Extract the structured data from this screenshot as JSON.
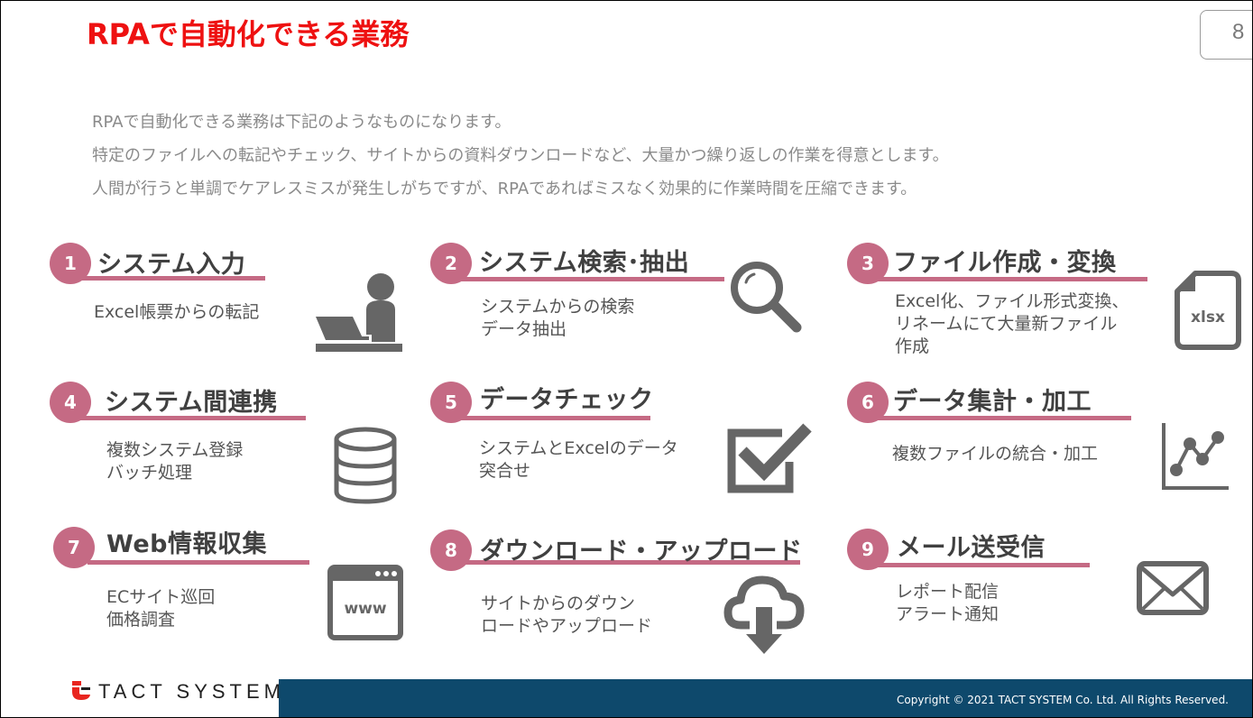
{
  "slide": {
    "title": "RPAで自動化できる業務",
    "page_number": "8",
    "intro_lines": [
      "RPAで自動化できる業務は下記のようなものになります。",
      "特定のファイルへの転記やチェック、サイトからの資料ダウンロードなど、大量かつ繰り返しの作業を得意とします。",
      "人間が行うと単調でケアレスミスが発生しがちですが、RPAであればミスなく効果的に作業時間を圧縮できます。"
    ]
  },
  "items": [
    {
      "number": "1",
      "title": "システム入力",
      "desc": [
        "Excel帳票からの転記"
      ],
      "icon": "person-at-laptop-icon"
    },
    {
      "number": "2",
      "title": "システム検索･抽出",
      "desc": [
        "システムからの検索",
        "データ抽出"
      ],
      "icon": "magnifier-icon"
    },
    {
      "number": "3",
      "title": "ファイル作成・変換",
      "desc": [
        "Excel化、ファイル形式変換、",
        "リネームにて大量新ファイル",
        "作成"
      ],
      "icon": "xlsx-file-icon",
      "icon_label": "xlsx"
    },
    {
      "number": "4",
      "title": "システム間連携",
      "desc": [
        "複数システム登録",
        "バッチ処理"
      ],
      "icon": "database-icon"
    },
    {
      "number": "5",
      "title": "データチェック",
      "desc": [
        "システムとExcelのデータ",
        "突合せ"
      ],
      "icon": "checkbox-icon"
    },
    {
      "number": "6",
      "title": "データ集計・加工",
      "desc": [
        "複数ファイルの統合・加工"
      ],
      "icon": "line-chart-icon"
    },
    {
      "number": "7",
      "title": "Web情報収集",
      "desc": [
        "ECサイト巡回",
        "価格調査"
      ],
      "icon": "browser-www-icon",
      "icon_label": "www"
    },
    {
      "number": "8",
      "title": "ダウンロード・アップロード",
      "desc": [
        "サイトからのダウン",
        "ロードやアップロード"
      ],
      "icon": "cloud-download-icon"
    },
    {
      "number": "9",
      "title": "メール送受信",
      "desc": [
        "レポート配信",
        "アラート通知"
      ],
      "icon": "envelope-icon"
    }
  ],
  "footer": {
    "logo_text": "TACT SYSTEM",
    "copyright": "Copyright © 2021 TACT SYSTEM Co. Ltd. All Rights Reserved."
  },
  "colors": {
    "title": "#ee1111",
    "accent": "#c56a84",
    "icon": "#666666",
    "footer_bar": "#0e496c",
    "logo_red": "#e8251f"
  }
}
